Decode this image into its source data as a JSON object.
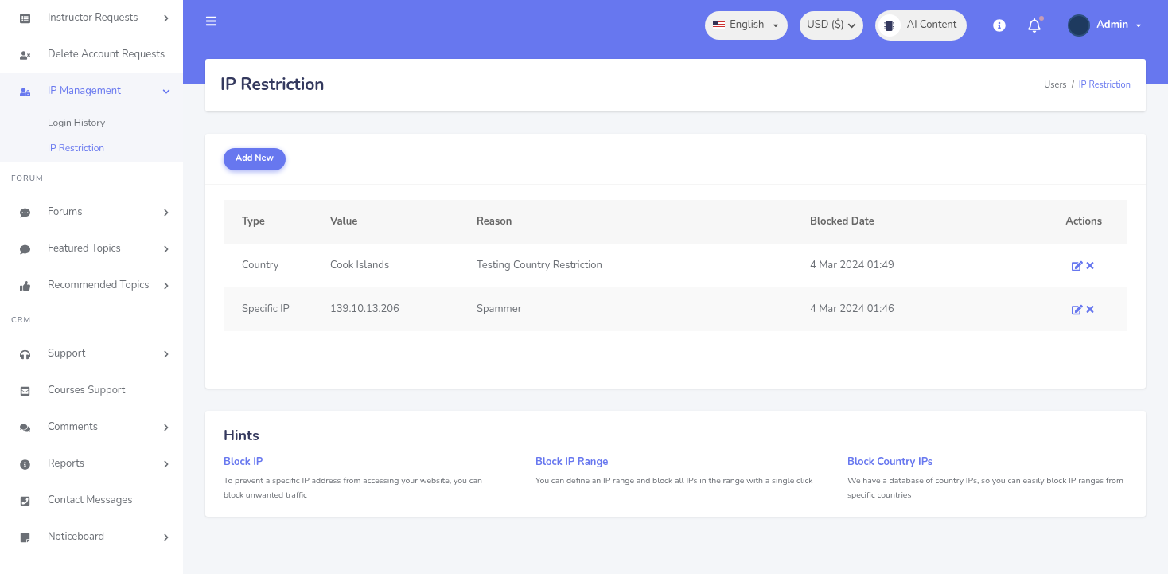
{
  "sidebar": {
    "items": [
      {
        "kind": "item",
        "label": "Instructor Requests",
        "has_submenu": true,
        "expanded": false
      },
      {
        "kind": "item",
        "label": "Delete Account Requests",
        "has_submenu": false,
        "expanded": false
      },
      {
        "kind": "item",
        "label": "IP Management",
        "has_submenu": true,
        "expanded": true,
        "children": [
          {
            "label": "Login History",
            "selected": false
          },
          {
            "label": "IP Restriction",
            "selected": true
          }
        ]
      },
      {
        "kind": "section",
        "label": "FORUM"
      },
      {
        "kind": "item",
        "label": "Forums",
        "has_submenu": true,
        "expanded": false
      },
      {
        "kind": "item",
        "label": "Featured Topics",
        "has_submenu": true,
        "expanded": false
      },
      {
        "kind": "item",
        "label": "Recommended Topics",
        "has_submenu": true,
        "expanded": false
      },
      {
        "kind": "section",
        "label": "CRM"
      },
      {
        "kind": "item",
        "label": "Support",
        "has_submenu": true,
        "expanded": false
      },
      {
        "kind": "item",
        "label": "Courses Support",
        "has_submenu": false,
        "expanded": false
      },
      {
        "kind": "item",
        "label": "Comments",
        "has_submenu": true,
        "expanded": false
      },
      {
        "kind": "item",
        "label": "Reports",
        "has_submenu": true,
        "expanded": false
      },
      {
        "kind": "item",
        "label": "Contact Messages",
        "has_submenu": false,
        "expanded": false
      },
      {
        "kind": "item",
        "label": "Noticeboard",
        "has_submenu": true,
        "expanded": false
      }
    ]
  },
  "topbar": {
    "language": "English",
    "currency": "USD ($)",
    "ai_button": "AI Content",
    "notification_unread": true,
    "user": "Admin"
  },
  "page": {
    "title": "IP Restriction",
    "breadcrumb_separator": "/",
    "breadcrumb": [
      {
        "label": "Users",
        "selected": false
      },
      {
        "label": "IP Restriction",
        "selected": true
      }
    ]
  },
  "add_button": "Add New",
  "table": {
    "columns": [
      "Type",
      "Value",
      "Reason",
      "Blocked Date",
      "Actions"
    ],
    "rows": [
      {
        "type": "Country",
        "value": "Cook Islands",
        "reason": "Testing Country Restriction",
        "date": "4 Mar 2024 01:49"
      },
      {
        "type": "Specific IP",
        "value": "139.10.13.206",
        "reason": "Spammer",
        "date": "4 Mar 2024 01:46"
      }
    ]
  },
  "hints": {
    "title": "Hints",
    "items": [
      {
        "title": "Block IP",
        "text": "To prevent a specific IP address from accessing your website, you can block unwanted traffic"
      },
      {
        "title": "Block IP Range",
        "text": "You can define an IP range and block all IPs in the range with a single click"
      },
      {
        "title": "Block Country IPs",
        "text": "We have a database of country IPs, so you can easily block IP ranges from specific countries"
      }
    ]
  }
}
